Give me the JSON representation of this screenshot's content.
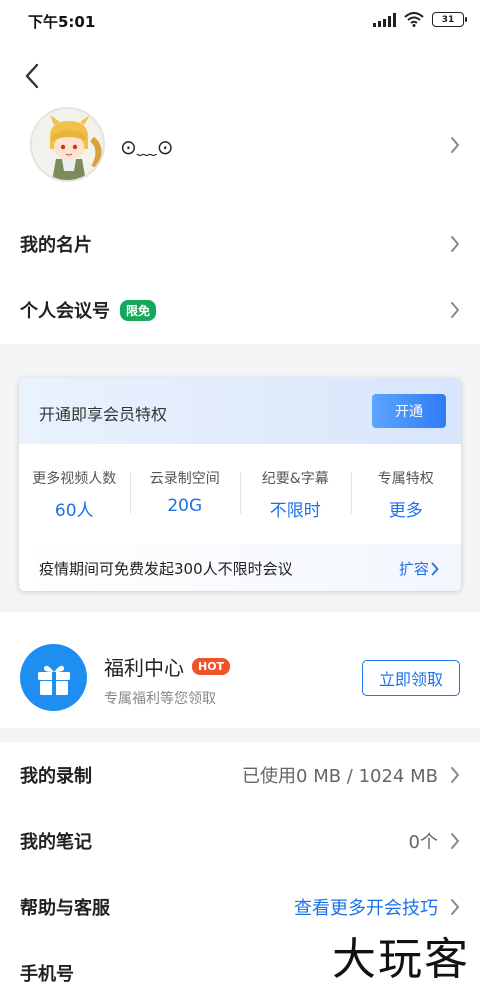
{
  "status": {
    "time": "下午5:01",
    "battery": "31"
  },
  "profile": {
    "nickname": "⊙﹏⊙"
  },
  "menu": {
    "card_label": "我的名片",
    "meeting_label": "个人会议号",
    "meeting_badge": "限免"
  },
  "member": {
    "title": "开通即享会员特权",
    "open_button": "开通",
    "stats": [
      {
        "label": "更多视频人数",
        "value": "60人"
      },
      {
        "label": "云录制空间",
        "value": "20G"
      },
      {
        "label": "纪要&字幕",
        "value": "不限时"
      },
      {
        "label": "专属特权",
        "value": "更多"
      }
    ],
    "footer_text": "疫情期间可免费发起300人不限时会议",
    "footer_link": "扩容"
  },
  "welfare": {
    "title": "福利中心",
    "badge": "HOT",
    "subtitle": "专属福利等您领取",
    "button": "立即领取"
  },
  "settings": {
    "recording_label": "我的录制",
    "recording_value": "已使用0 MB / 1024 MB",
    "notes_label": "我的笔记",
    "notes_value": "0个",
    "help_label": "帮助与客服",
    "help_value": "查看更多开会技巧",
    "phone_label": "手机号"
  },
  "watermark": "大玩客",
  "colors": {
    "accent": "#1a73e8",
    "badge_green": "#16a85a",
    "hot": "#f0522a",
    "gift_blue": "#1f8ef1"
  }
}
